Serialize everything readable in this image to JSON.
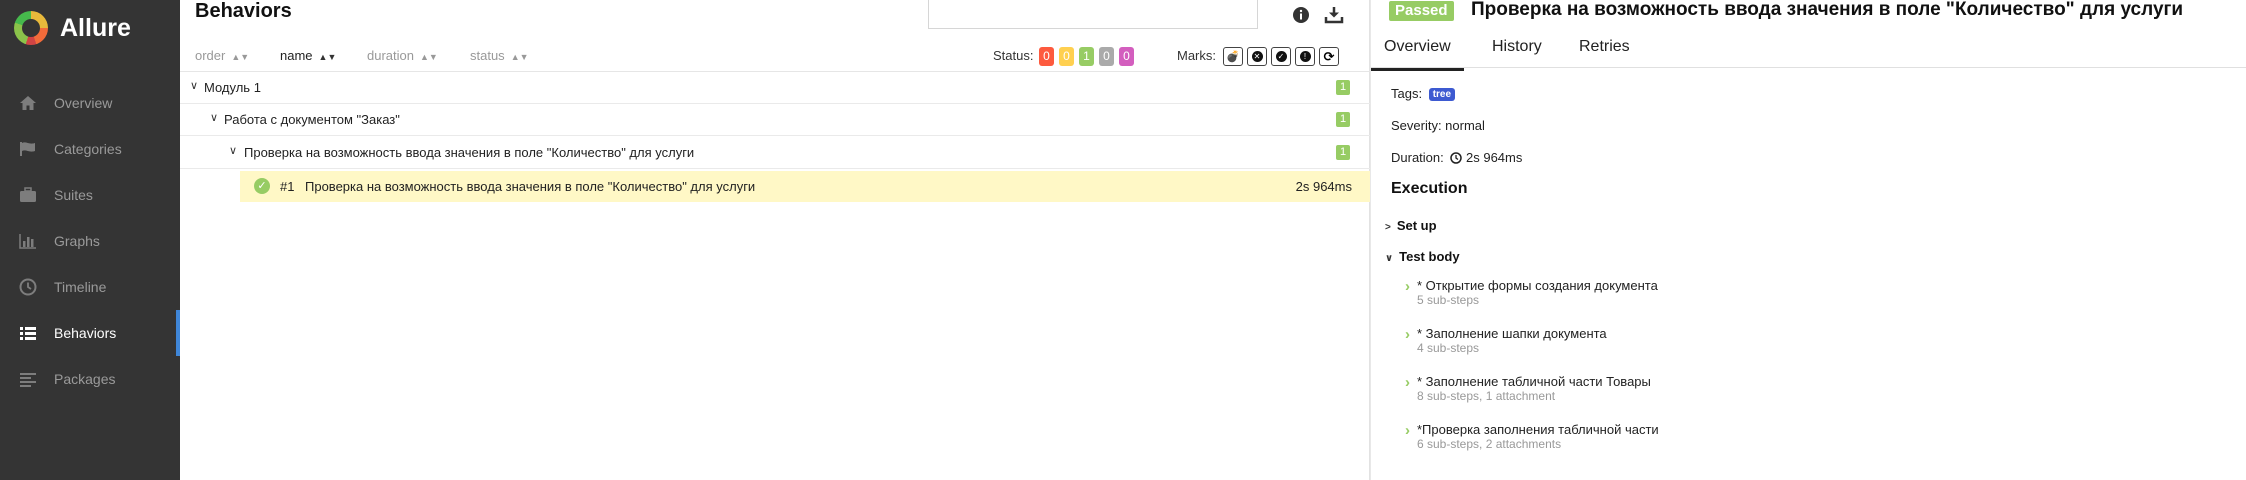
{
  "app": {
    "name": "Allure"
  },
  "sidebar": {
    "items": [
      {
        "label": "Overview",
        "icon": "home-icon"
      },
      {
        "label": "Categories",
        "icon": "flag-icon"
      },
      {
        "label": "Suites",
        "icon": "briefcase-icon"
      },
      {
        "label": "Graphs",
        "icon": "bar-chart-icon"
      },
      {
        "label": "Timeline",
        "icon": "clock-icon"
      },
      {
        "label": "Behaviors",
        "icon": "list-icon",
        "active": true
      },
      {
        "label": "Packages",
        "icon": "align-left-icon"
      }
    ]
  },
  "middle": {
    "title": "Behaviors",
    "sort": {
      "order": "order",
      "name": "name",
      "duration": "duration",
      "status": "status"
    },
    "status_label": "Status:",
    "status_counts": [
      {
        "value": "0",
        "color": "#fd5a3e"
      },
      {
        "value": "0",
        "color": "#ffd050"
      },
      {
        "value": "1",
        "color": "#97cc64"
      },
      {
        "value": "0",
        "color": "#aaaaaa"
      },
      {
        "value": "0",
        "color": "#d35ebe"
      }
    ],
    "marks_label": "Marks:",
    "tree": [
      {
        "label": "Модуль 1",
        "count": "1"
      },
      {
        "label": "Работа с документом \"Заказ\"",
        "count": "1"
      },
      {
        "label": "Проверка на возможность ввода значения в поле \"Количество\" для услуги",
        "count": "1"
      }
    ],
    "leaf": {
      "number": "#1",
      "name": "Проверка на возможность ввода значения в поле \"Количество\" для услуги",
      "duration": "2s 964ms"
    }
  },
  "details": {
    "status": "Passed",
    "title": "Проверка на возможность ввода значения в поле \"Количество\" для услуги",
    "tabs": [
      "Overview",
      "History",
      "Retries"
    ],
    "tags_label": "Tags:",
    "tag": "tree",
    "severity": "Severity: normal",
    "duration_label": "Duration:",
    "duration": "2s 964ms",
    "execution_title": "Execution",
    "setup": "Set up",
    "test_body": "Test body",
    "steps": [
      {
        "name": "* Открытие формы создания документа",
        "sub": "5 sub-steps"
      },
      {
        "name": "* Заполнение шапки документа",
        "sub": "4 sub-steps"
      },
      {
        "name": "* Заполнение табличной части Товары",
        "sub": "8 sub-steps, 1 attachment"
      },
      {
        "name": "*Проверка заполнения табличной части",
        "sub": "6 sub-steps, 2 attachments"
      }
    ]
  }
}
